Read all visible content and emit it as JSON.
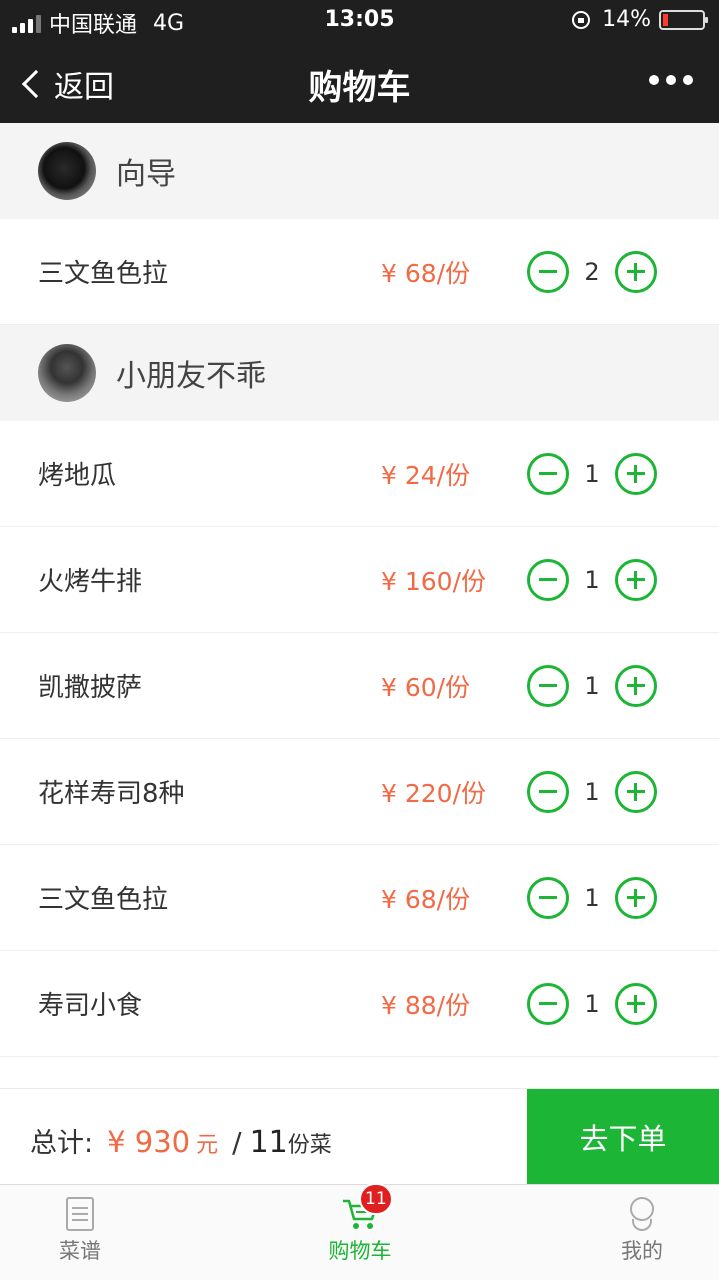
{
  "status_bar": {
    "carrier": "中国联通",
    "network": "4G",
    "time": "13:05",
    "battery": "14%",
    "battery_level": 0.14
  },
  "nav": {
    "back_label": "返回",
    "title": "购物车"
  },
  "groups": [
    {
      "name": "向导",
      "items": [
        {
          "name": "三文鱼色拉",
          "price": "¥ 68/份",
          "qty": "2"
        }
      ]
    },
    {
      "name": "小朋友不乖",
      "items": [
        {
          "name": "烤地瓜",
          "price": "¥ 24/份",
          "qty": "1"
        },
        {
          "name": "火烤牛排",
          "price": "¥ 160/份",
          "qty": "1"
        },
        {
          "name": "凯撒披萨",
          "price": "¥ 60/份",
          "qty": "1"
        },
        {
          "name": "花样寿司8种",
          "price": "¥ 220/份",
          "qty": "1"
        },
        {
          "name": "三文鱼色拉",
          "price": "¥ 68/份",
          "qty": "1"
        },
        {
          "name": "寿司小食",
          "price": "¥ 88/份",
          "qty": "1"
        }
      ]
    }
  ],
  "total": {
    "label": "总计:",
    "amount": "¥ 930",
    "unit": "元",
    "slash": "/",
    "count": "11",
    "dishes": "份菜"
  },
  "order_button": "去下单",
  "tabs": [
    {
      "label": "菜谱",
      "icon": "book-icon"
    },
    {
      "label": "购物车",
      "icon": "cart-icon",
      "badge": "11"
    },
    {
      "label": "我的",
      "icon": "person-icon"
    }
  ],
  "colors": {
    "accent": "#1db535",
    "price": "#f26a45",
    "header_bg": "#1f1f1f",
    "badge": "#e02020"
  }
}
